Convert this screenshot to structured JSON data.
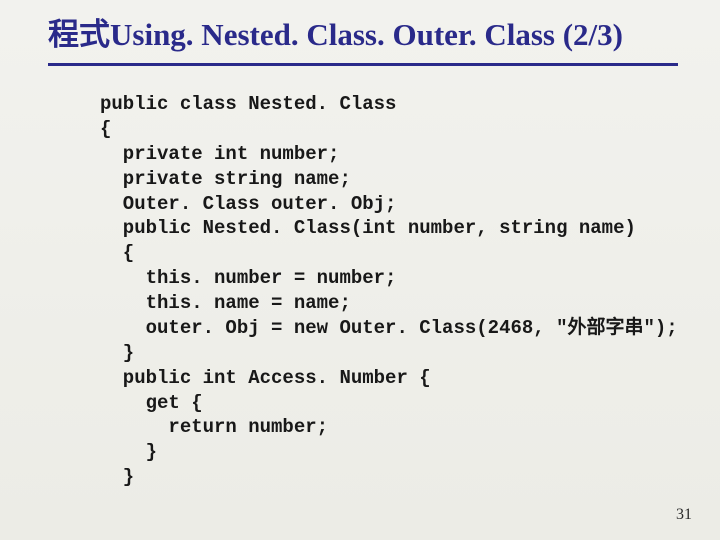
{
  "title": "程式Using. Nested. Class. Outer. Class (2/3)",
  "code": "public class Nested. Class\n{\n  private int number;\n  private string name;\n  Outer. Class outer. Obj;\n  public Nested. Class(int number, string name)\n  {\n    this. number = number;\n    this. name = name;\n    outer. Obj = new Outer. Class(2468, \"外部字串\");\n  }\n  public int Access. Number {\n    get {\n      return number;\n    }\n  }",
  "page_number": "31"
}
